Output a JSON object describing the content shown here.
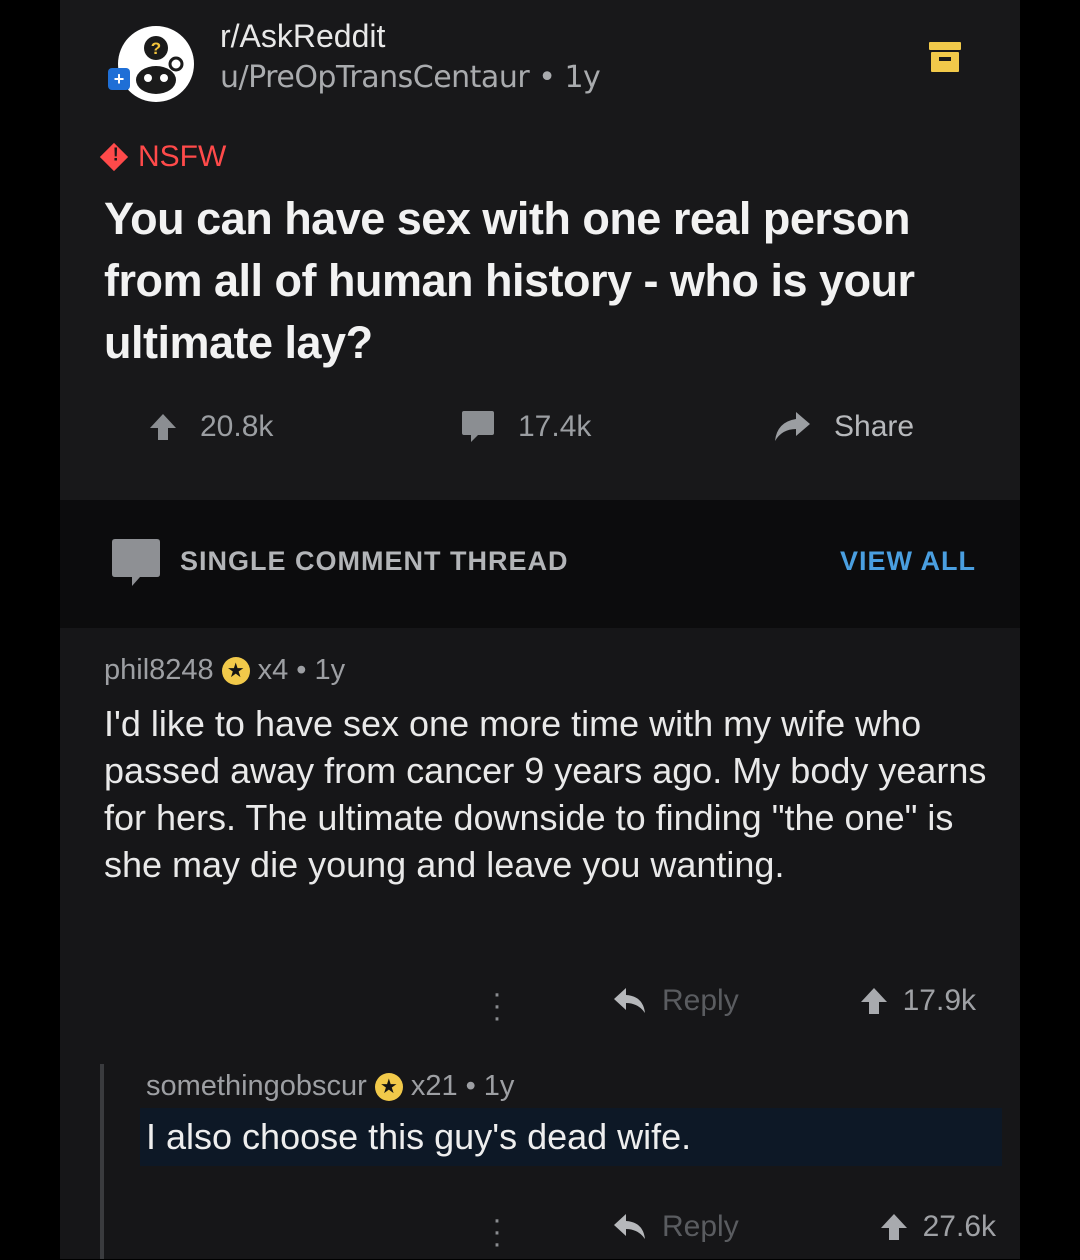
{
  "post": {
    "subreddit": "r/AskReddit",
    "author": "u/PreOpTransCentaur",
    "age": "1y",
    "nsfw_label": "NSFW",
    "title": "You can have sex with one real person from all of human history - who is your ultimate lay?",
    "upvotes": "20.8k",
    "comments": "17.4k",
    "share_label": "Share",
    "icons": [
      "avatar",
      "save-icon",
      "upvote-icon",
      "comment-icon",
      "share-icon"
    ]
  },
  "thread": {
    "label": "SINGLE COMMENT THREAD",
    "view_all": "VIEW ALL"
  },
  "comment": {
    "author": "phil8248",
    "awards": "x4",
    "age": "1y",
    "body": "I'd like to have sex one more time with my wife who passed away from cancer 9 years ago. My body yearns for hers. The ultimate downside to finding \"the one\" is she may die young and leave you wanting.",
    "reply_label": "Reply",
    "votes": "17.9k"
  },
  "reply": {
    "author": "somethingobscur",
    "awards": "x21",
    "age": "1y",
    "body": "I also choose this guy's dead wife.",
    "reply_label": "Reply",
    "votes": "27.6k"
  },
  "colors": {
    "nsfw": "#ff4a4a",
    "view_all": "#4a9fe0",
    "award": "#f1c94a",
    "background": "#141416"
  }
}
